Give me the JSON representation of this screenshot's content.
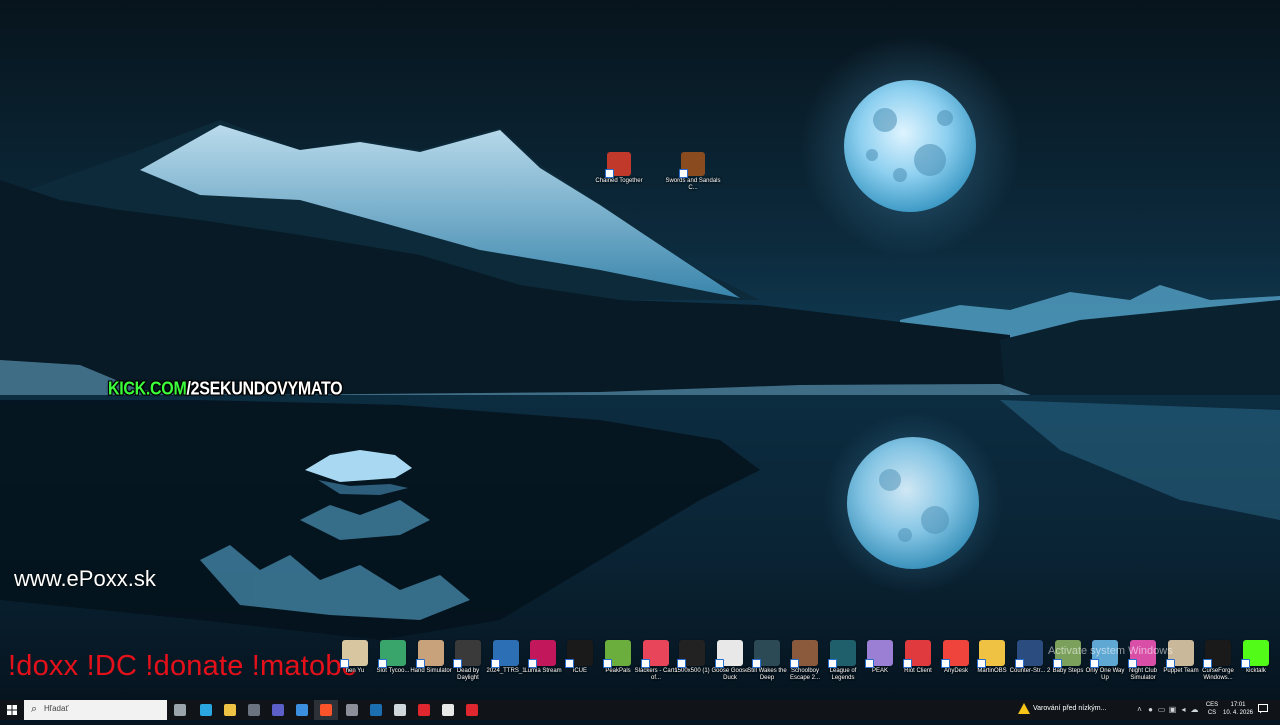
{
  "overlay": {
    "kick_part1": "KICK.COM",
    "kick_part2": "/2SEKUNDOVYMATO",
    "site": "www.ePoxx.sk",
    "commands": "!doxx  !DC !donate !matobc"
  },
  "desktop_icons_top": [
    {
      "label": "Chained Together",
      "icon": "chained-together-icon",
      "color": "#c0392b"
    },
    {
      "label": "Swords and Sandals C...",
      "icon": "swords-and-sandals-icon",
      "color": "#8a4b1f"
    }
  ],
  "desktop_icons_row": [
    {
      "label": "hen Yu",
      "icon": "game-icon",
      "color": "#d7c6a0"
    },
    {
      "label": "Slot Tycoo...",
      "icon": "slot-tycoon-icon",
      "color": "#3aa56a"
    },
    {
      "label": "Hand Simulator",
      "icon": "hand-simulator-icon",
      "color": "#c7a27a"
    },
    {
      "label": "Dead by Daylight",
      "icon": "dead-by-daylight-icon",
      "color": "#3a3a3a"
    },
    {
      "label": "2024_TTRS_1",
      "icon": "file-icon",
      "color": "#2d6fb5"
    },
    {
      "label": "Lumia Stream",
      "icon": "lumia-stream-icon",
      "color": "#c2185b"
    },
    {
      "label": "iCUE",
      "icon": "icue-icon",
      "color": "#1a1a1a"
    },
    {
      "label": "PeakPals",
      "icon": "peakpals-icon",
      "color": "#6cae3e"
    },
    {
      "label": "Slackers - Carts of...",
      "icon": "slackers-icon",
      "color": "#e8445a"
    },
    {
      "label": "1500x500 (1)",
      "icon": "image-file-icon",
      "color": "#222222"
    },
    {
      "label": "Goose Goose Duck",
      "icon": "goose-goose-duck-icon",
      "color": "#e8e8e8"
    },
    {
      "label": "Still Wakes the Deep",
      "icon": "still-wakes-the-deep-icon",
      "color": "#2b4a55"
    },
    {
      "label": "Schoolboy Escape 2...",
      "icon": "schoolboy-escape-icon",
      "color": "#8b5a3c"
    },
    {
      "label": "League of Legends",
      "icon": "league-of-legends-icon",
      "color": "#1e5f6b"
    },
    {
      "label": "PEAK",
      "icon": "peak-icon",
      "color": "#9b7fd4"
    },
    {
      "label": "Riot Client",
      "icon": "riot-client-icon",
      "color": "#e03a3e"
    },
    {
      "label": "AnyDesk",
      "icon": "anydesk-icon",
      "color": "#ef443b"
    },
    {
      "label": "MartinOBS",
      "icon": "folder-icon",
      "color": "#f0c243"
    },
    {
      "label": "Counter-Str... 2",
      "icon": "counter-strike-icon",
      "color": "#2b4c7e"
    },
    {
      "label": "Baby Steps",
      "icon": "baby-steps-icon",
      "color": "#7ba05b"
    },
    {
      "label": "Only One Way Up",
      "icon": "only-one-way-up-icon",
      "color": "#5fa8d3"
    },
    {
      "label": "Night Club Simulator",
      "icon": "night-club-simulator-icon",
      "color": "#d94fa8"
    },
    {
      "label": "Puppet Team",
      "icon": "puppet-team-icon",
      "color": "#c9b89a"
    },
    {
      "label": "CurseForge Windows...",
      "icon": "curseforge-icon",
      "color": "#1a1a1a"
    },
    {
      "label": "kicktalk",
      "icon": "kicktalk-icon",
      "color": "#53fc18"
    }
  ],
  "watermark": "Activate system Windows",
  "taskbar": {
    "search_placeholder": "Hľadať",
    "apps": [
      {
        "icon": "task-view-icon",
        "color": "#9aa4ad",
        "active": false
      },
      {
        "icon": "edge-icon",
        "color": "#2aa7e0",
        "active": false
      },
      {
        "icon": "file-explorer-icon",
        "color": "#f0c243",
        "active": false
      },
      {
        "icon": "store-icon",
        "color": "#6b7380",
        "active": false
      },
      {
        "icon": "teams-icon",
        "color": "#5b5fc7",
        "active": false
      },
      {
        "icon": "app-icon",
        "color": "#3b8ee0",
        "active": false
      },
      {
        "icon": "brave-icon",
        "color": "#fb542b",
        "active": true
      },
      {
        "icon": "obs-icon",
        "color": "#8a8f99",
        "active": false
      },
      {
        "icon": "steam-icon",
        "color": "#1b6fb0",
        "active": false
      },
      {
        "icon": "chat-icon",
        "color": "#cfd6dc",
        "active": false
      },
      {
        "icon": "opera-icon",
        "color": "#e0262f",
        "active": false
      },
      {
        "icon": "app-icon",
        "color": "#e8e8e8",
        "active": false
      },
      {
        "icon": "record-icon",
        "color": "#e0262f",
        "active": false
      }
    ],
    "warning_text": "Varování před nízkým...",
    "lang_line1": "CES",
    "lang_line2": "CS",
    "time": "17:01",
    "date": "10. 4. 2026"
  },
  "colors": {
    "kick_green": "#3cff3c",
    "command_red": "#e4101a",
    "taskbar_bg": "#101418"
  }
}
